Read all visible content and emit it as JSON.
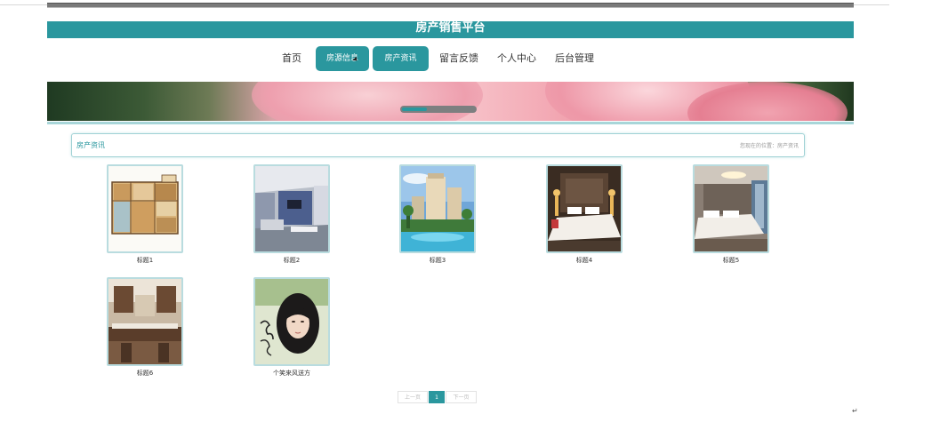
{
  "app": {
    "title": "房产销售平台"
  },
  "nav": {
    "items": [
      {
        "label": "首页"
      },
      {
        "label": "房源信息"
      },
      {
        "label": "房产资讯"
      },
      {
        "label": "留言反馈"
      },
      {
        "label": "个人中心"
      },
      {
        "label": "后台管理"
      }
    ]
  },
  "breadcrumb": {
    "title": "房产资讯",
    "location": "您现在的位置：房产资讯"
  },
  "cards": [
    {
      "caption": "标题1",
      "image": "floor-plan"
    },
    {
      "caption": "标题2",
      "image": "living-room"
    },
    {
      "caption": "标题3",
      "image": "apartment-buildings"
    },
    {
      "caption": "标题4",
      "image": "hotel-bedroom"
    },
    {
      "caption": "标题5",
      "image": "bedroom-chandelier"
    },
    {
      "caption": "标题6",
      "image": "kitchen"
    },
    {
      "caption": "个笑来风送方",
      "image": "portrait"
    }
  ],
  "pagination": {
    "prev": "上一页",
    "current": "1",
    "next": "下一页"
  },
  "colors": {
    "accent": "#2a979e"
  }
}
